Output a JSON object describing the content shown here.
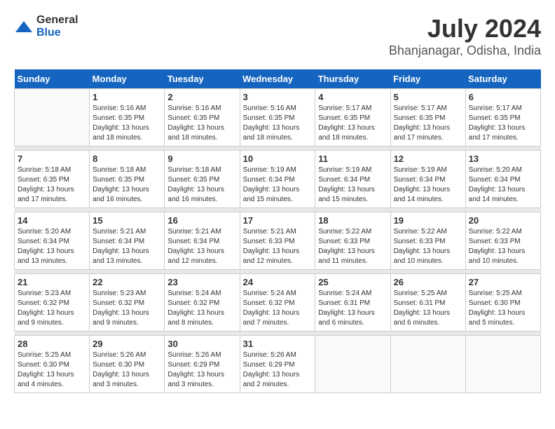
{
  "logo": {
    "general": "General",
    "blue": "Blue"
  },
  "title": "July 2024",
  "subtitle": "Bhanjanagar, Odisha, India",
  "headers": [
    "Sunday",
    "Monday",
    "Tuesday",
    "Wednesday",
    "Thursday",
    "Friday",
    "Saturday"
  ],
  "weeks": [
    [
      {
        "day": "",
        "sunrise": "",
        "sunset": "",
        "daylight": ""
      },
      {
        "day": "1",
        "sunrise": "Sunrise: 5:16 AM",
        "sunset": "Sunset: 6:35 PM",
        "daylight": "Daylight: 13 hours and 18 minutes."
      },
      {
        "day": "2",
        "sunrise": "Sunrise: 5:16 AM",
        "sunset": "Sunset: 6:35 PM",
        "daylight": "Daylight: 13 hours and 18 minutes."
      },
      {
        "day": "3",
        "sunrise": "Sunrise: 5:16 AM",
        "sunset": "Sunset: 6:35 PM",
        "daylight": "Daylight: 13 hours and 18 minutes."
      },
      {
        "day": "4",
        "sunrise": "Sunrise: 5:17 AM",
        "sunset": "Sunset: 6:35 PM",
        "daylight": "Daylight: 13 hours and 18 minutes."
      },
      {
        "day": "5",
        "sunrise": "Sunrise: 5:17 AM",
        "sunset": "Sunset: 6:35 PM",
        "daylight": "Daylight: 13 hours and 17 minutes."
      },
      {
        "day": "6",
        "sunrise": "Sunrise: 5:17 AM",
        "sunset": "Sunset: 6:35 PM",
        "daylight": "Daylight: 13 hours and 17 minutes."
      }
    ],
    [
      {
        "day": "7",
        "sunrise": "Sunrise: 5:18 AM",
        "sunset": "Sunset: 6:35 PM",
        "daylight": "Daylight: 13 hours and 17 minutes."
      },
      {
        "day": "8",
        "sunrise": "Sunrise: 5:18 AM",
        "sunset": "Sunset: 6:35 PM",
        "daylight": "Daylight: 13 hours and 16 minutes."
      },
      {
        "day": "9",
        "sunrise": "Sunrise: 5:18 AM",
        "sunset": "Sunset: 6:35 PM",
        "daylight": "Daylight: 13 hours and 16 minutes."
      },
      {
        "day": "10",
        "sunrise": "Sunrise: 5:19 AM",
        "sunset": "Sunset: 6:34 PM",
        "daylight": "Daylight: 13 hours and 15 minutes."
      },
      {
        "day": "11",
        "sunrise": "Sunrise: 5:19 AM",
        "sunset": "Sunset: 6:34 PM",
        "daylight": "Daylight: 13 hours and 15 minutes."
      },
      {
        "day": "12",
        "sunrise": "Sunrise: 5:19 AM",
        "sunset": "Sunset: 6:34 PM",
        "daylight": "Daylight: 13 hours and 14 minutes."
      },
      {
        "day": "13",
        "sunrise": "Sunrise: 5:20 AM",
        "sunset": "Sunset: 6:34 PM",
        "daylight": "Daylight: 13 hours and 14 minutes."
      }
    ],
    [
      {
        "day": "14",
        "sunrise": "Sunrise: 5:20 AM",
        "sunset": "Sunset: 6:34 PM",
        "daylight": "Daylight: 13 hours and 13 minutes."
      },
      {
        "day": "15",
        "sunrise": "Sunrise: 5:21 AM",
        "sunset": "Sunset: 6:34 PM",
        "daylight": "Daylight: 13 hours and 13 minutes."
      },
      {
        "day": "16",
        "sunrise": "Sunrise: 5:21 AM",
        "sunset": "Sunset: 6:34 PM",
        "daylight": "Daylight: 13 hours and 12 minutes."
      },
      {
        "day": "17",
        "sunrise": "Sunrise: 5:21 AM",
        "sunset": "Sunset: 6:33 PM",
        "daylight": "Daylight: 13 hours and 12 minutes."
      },
      {
        "day": "18",
        "sunrise": "Sunrise: 5:22 AM",
        "sunset": "Sunset: 6:33 PM",
        "daylight": "Daylight: 13 hours and 11 minutes."
      },
      {
        "day": "19",
        "sunrise": "Sunrise: 5:22 AM",
        "sunset": "Sunset: 6:33 PM",
        "daylight": "Daylight: 13 hours and 10 minutes."
      },
      {
        "day": "20",
        "sunrise": "Sunrise: 5:22 AM",
        "sunset": "Sunset: 6:33 PM",
        "daylight": "Daylight: 13 hours and 10 minutes."
      }
    ],
    [
      {
        "day": "21",
        "sunrise": "Sunrise: 5:23 AM",
        "sunset": "Sunset: 6:32 PM",
        "daylight": "Daylight: 13 hours and 9 minutes."
      },
      {
        "day": "22",
        "sunrise": "Sunrise: 5:23 AM",
        "sunset": "Sunset: 6:32 PM",
        "daylight": "Daylight: 13 hours and 9 minutes."
      },
      {
        "day": "23",
        "sunrise": "Sunrise: 5:24 AM",
        "sunset": "Sunset: 6:32 PM",
        "daylight": "Daylight: 13 hours and 8 minutes."
      },
      {
        "day": "24",
        "sunrise": "Sunrise: 5:24 AM",
        "sunset": "Sunset: 6:32 PM",
        "daylight": "Daylight: 13 hours and 7 minutes."
      },
      {
        "day": "25",
        "sunrise": "Sunrise: 5:24 AM",
        "sunset": "Sunset: 6:31 PM",
        "daylight": "Daylight: 13 hours and 6 minutes."
      },
      {
        "day": "26",
        "sunrise": "Sunrise: 5:25 AM",
        "sunset": "Sunset: 6:31 PM",
        "daylight": "Daylight: 13 hours and 6 minutes."
      },
      {
        "day": "27",
        "sunrise": "Sunrise: 5:25 AM",
        "sunset": "Sunset: 6:30 PM",
        "daylight": "Daylight: 13 hours and 5 minutes."
      }
    ],
    [
      {
        "day": "28",
        "sunrise": "Sunrise: 5:25 AM",
        "sunset": "Sunset: 6:30 PM",
        "daylight": "Daylight: 13 hours and 4 minutes."
      },
      {
        "day": "29",
        "sunrise": "Sunrise: 5:26 AM",
        "sunset": "Sunset: 6:30 PM",
        "daylight": "Daylight: 13 hours and 3 minutes."
      },
      {
        "day": "30",
        "sunrise": "Sunrise: 5:26 AM",
        "sunset": "Sunset: 6:29 PM",
        "daylight": "Daylight: 13 hours and 3 minutes."
      },
      {
        "day": "31",
        "sunrise": "Sunrise: 5:26 AM",
        "sunset": "Sunset: 6:29 PM",
        "daylight": "Daylight: 13 hours and 2 minutes."
      },
      {
        "day": "",
        "sunrise": "",
        "sunset": "",
        "daylight": ""
      },
      {
        "day": "",
        "sunrise": "",
        "sunset": "",
        "daylight": ""
      },
      {
        "day": "",
        "sunrise": "",
        "sunset": "",
        "daylight": ""
      }
    ]
  ]
}
